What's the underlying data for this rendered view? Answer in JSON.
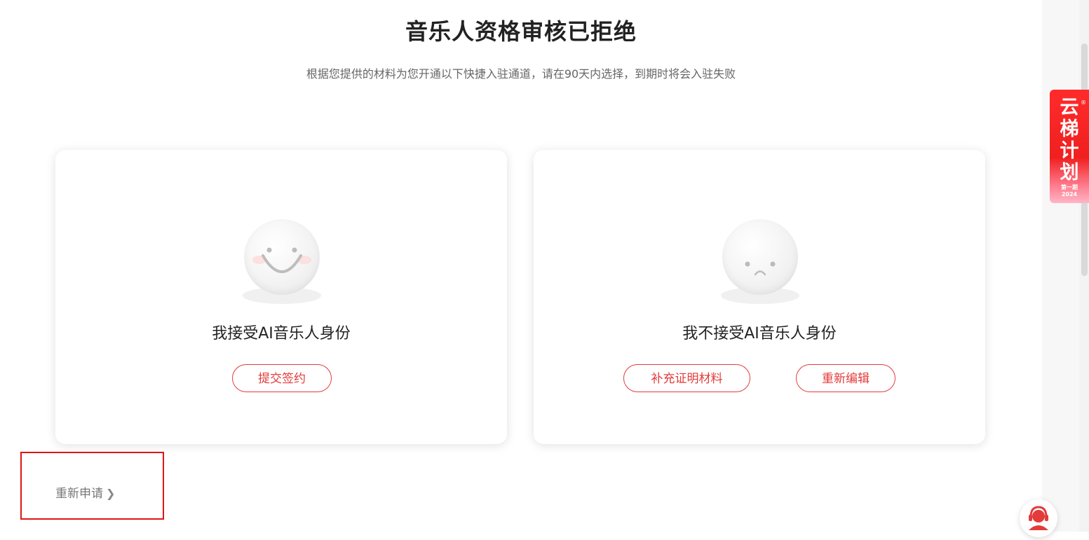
{
  "header": {
    "title": "音乐人资格审核已拒绝",
    "subtitle": "根据您提供的材料为您开通以下快捷入驻通道，请在90天内选择，到期时将会入驻失败"
  },
  "cards": {
    "accept": {
      "icon": "smile-face-icon",
      "title": "我接受AI音乐人身份",
      "button": "提交签约"
    },
    "reject": {
      "icon": "sad-face-icon",
      "title": "我不接受AI音乐人身份",
      "buttons": {
        "supplement": "补充证明材料",
        "edit": "重新编辑"
      }
    }
  },
  "footer": {
    "reapply_label": "重新申请",
    "reapply_icon": "chevron-right-icon"
  },
  "sidebar": {
    "promo_title": "云梯计划",
    "promo_sub_line1": "第一期",
    "promo_sub_line2": "2024",
    "promo_mark": "®",
    "support_icon": "customer-service-icon"
  },
  "colors": {
    "accent": "#e33b3b",
    "highlight_box": "#e01414",
    "promo_red": "#f02020"
  }
}
